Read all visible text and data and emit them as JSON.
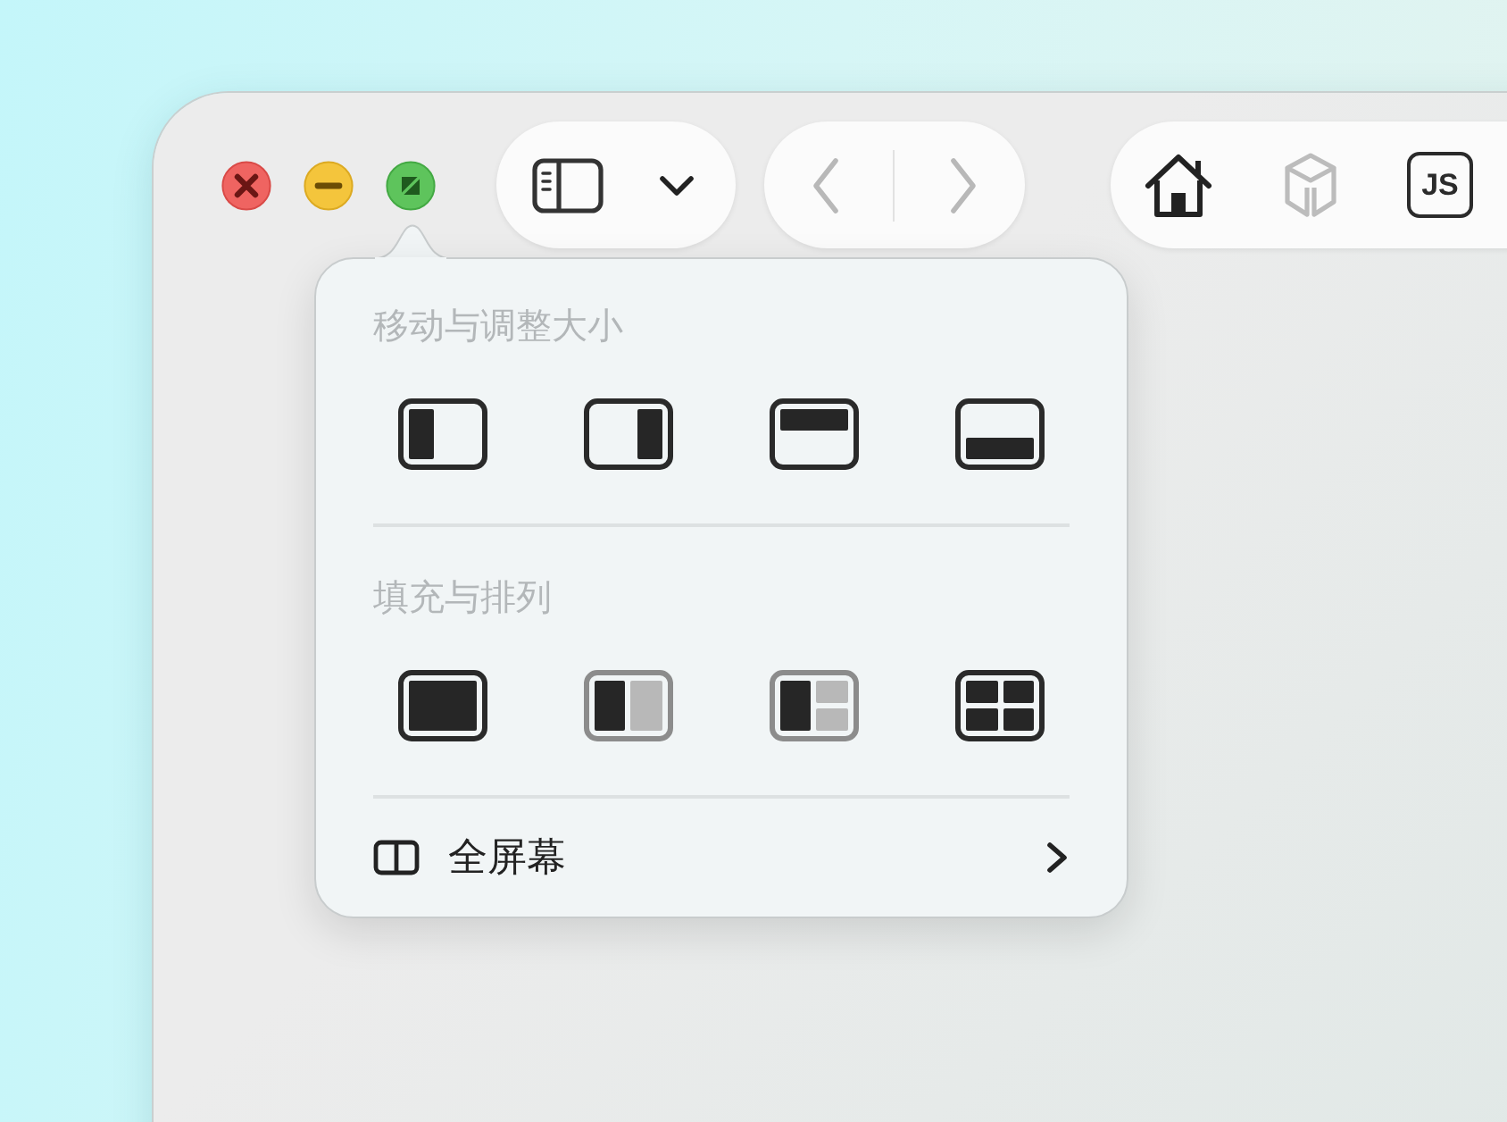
{
  "window": {
    "controls": [
      {
        "kind": "close"
      },
      {
        "kind": "minimize"
      },
      {
        "kind": "zoom"
      }
    ]
  },
  "toolbar": {
    "sidebar": [
      {
        "kind": "sidebar"
      },
      {
        "kind": "chevron"
      }
    ],
    "navigation": [
      {
        "kind": "back",
        "disabled": true
      },
      {
        "kind": "forward",
        "disabled": true
      }
    ],
    "tools": [
      {
        "kind": "home",
        "disabled": false
      },
      {
        "kind": "cube",
        "disabled": true
      },
      {
        "kind": "js",
        "label": "JS",
        "disabled": false
      }
    ]
  },
  "popover": {
    "sections": [
      {
        "title": "移动与调整大小",
        "tiles": [
          {
            "kind": "left"
          },
          {
            "kind": "right"
          },
          {
            "kind": "top"
          },
          {
            "kind": "bottom"
          }
        ]
      },
      {
        "title": "填充与排列",
        "tiles": [
          {
            "kind": "fill"
          },
          {
            "kind": "halves"
          },
          {
            "kind": "thirds"
          },
          {
            "kind": "quarters"
          }
        ]
      }
    ],
    "footer": {
      "label": "全屏幕"
    }
  }
}
